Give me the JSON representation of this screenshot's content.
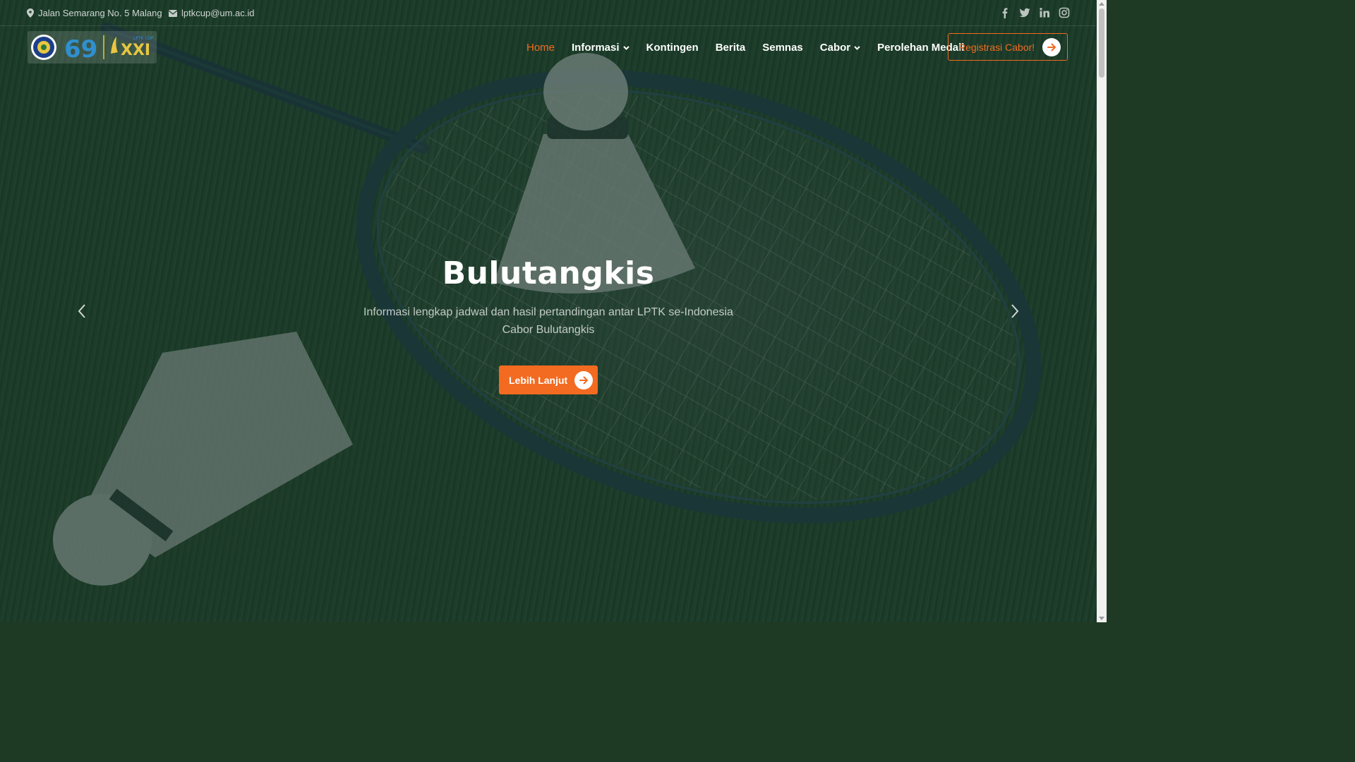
{
  "topbar": {
    "address": "Jalan Semarang No. 5 Malang",
    "email": "lptkcup@um.ac.id",
    "social": [
      "facebook-icon",
      "twitter-icon",
      "linkedin-icon",
      "instagram-icon"
    ]
  },
  "logo": {
    "anniversary": "69",
    "edition": "XXI",
    "event": "LPTK CUP"
  },
  "nav": {
    "items": [
      {
        "label": "Home",
        "active": true
      },
      {
        "label": "Informasi",
        "dropdown": true
      },
      {
        "label": "Kontingen"
      },
      {
        "label": "Berita"
      },
      {
        "label": "Semnas"
      },
      {
        "label": "Cabor",
        "dropdown": true
      },
      {
        "label": "Perolehan Medali"
      }
    ],
    "cta_label": "Registrasi Cabor!"
  },
  "hero": {
    "title": "Bulutangkis",
    "subtitle_line1": "Informasi lengkap jadwal dan hasil pertandingan antar LPTK se-Indonesia",
    "subtitle_line2": "Cabor Bulutangkis",
    "button_label": "Lebih Lanjut"
  },
  "colors": {
    "accent": "#f26b21",
    "overlay": "#163028"
  }
}
